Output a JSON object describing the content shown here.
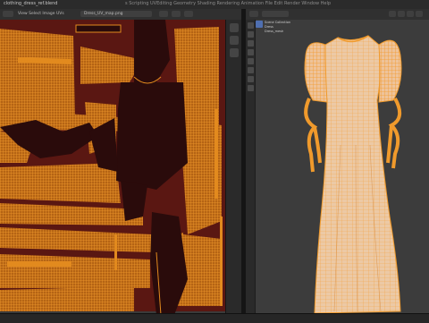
{
  "app": {
    "title": "clothing_dress_ref.blend",
    "topbar_text": "s Scripting  UVEditing   Geometry  Shading  Rendering  Animation  File  Edit  Render  Window  Help"
  },
  "uv_editor": {
    "header_text": "View  Select  Image  UVs",
    "image_name": "Dress_UV_map.png"
  },
  "viewport": {
    "outliner_lines": [
      "Scene Collection",
      "Dress",
      "Dress_mesh"
    ]
  },
  "colors": {
    "uv_background": "#5a1712",
    "uv_mesh": "#e28a1e",
    "island_dark": "#2a0b0b",
    "dress_fill": "#e9c7a3",
    "dress_wire": "#f09a2c",
    "viewport_bg": "#3c3c3c"
  }
}
